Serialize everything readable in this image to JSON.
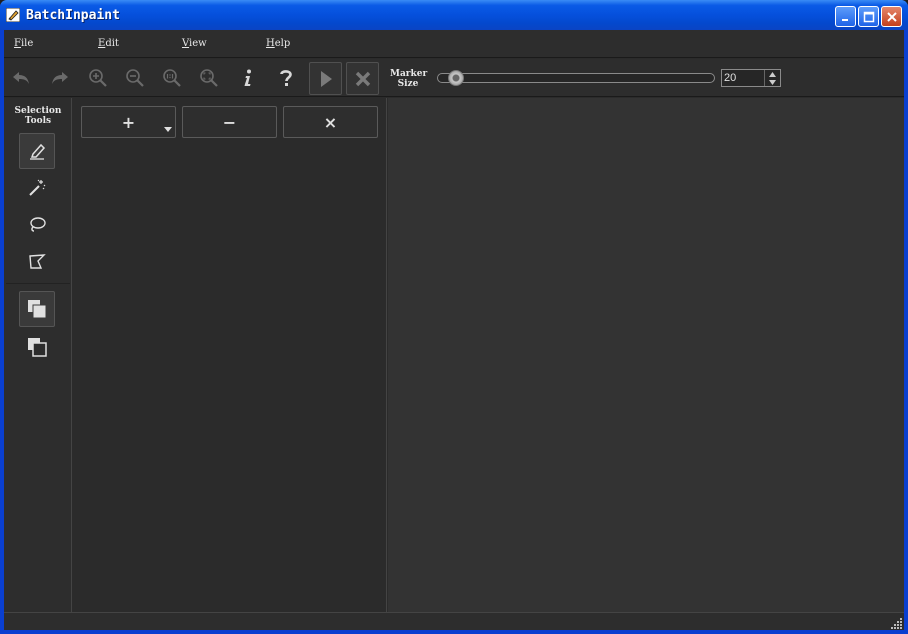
{
  "window": {
    "title": "BatchInpaint"
  },
  "menu": {
    "items": [
      {
        "underline": "F",
        "rest": "ile"
      },
      {
        "underline": "E",
        "rest": "dit"
      },
      {
        "underline": "V",
        "rest": "iew"
      },
      {
        "underline": "H",
        "rest": "elp"
      }
    ]
  },
  "toolbar": {
    "icons": [
      "undo-icon",
      "redo-icon",
      "zoom-in-icon",
      "zoom-out-icon",
      "zoom-actual-size-icon",
      "zoom-fit-icon",
      "info-icon",
      "help-icon",
      "run-icon",
      "stop-icon"
    ],
    "marker_label_line1": "Marker",
    "marker_label_line2": "Size",
    "marker_size_value": "20"
  },
  "tool_panel": {
    "label_line1": "Selection",
    "label_line2": "Tools",
    "tools": [
      "marker-icon",
      "magic-wand-icon",
      "lasso-icon",
      "polygon-lasso-icon"
    ],
    "modes": [
      "add-selection-mode-icon",
      "subtract-selection-mode-icon"
    ]
  },
  "list_panel": {
    "add_label": "+",
    "remove_label": "−",
    "clear_label": "×"
  },
  "colors": {
    "background": "#2b2b2b",
    "canvas": "#333333",
    "titlebar": "#0550dc"
  }
}
